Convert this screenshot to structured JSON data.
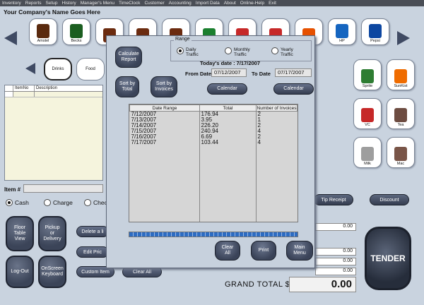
{
  "menubar": [
    "Inventory",
    "Reports",
    "Setup",
    "History",
    "Manager's Menu",
    "TimeClock",
    "Customer",
    "Accounting",
    "Import Data",
    "About",
    "Online-Help",
    "Exit"
  ],
  "company_name": "Your Company's Name Goes Here",
  "products_top": [
    {
      "label": "Amstel",
      "color": "#5a2a0e"
    },
    {
      "label": "Becks",
      "color": "#1b5e20"
    },
    {
      "label": "",
      "color": "#6b2b0f"
    },
    {
      "label": "",
      "color": "#6b2b0f"
    },
    {
      "label": "",
      "color": "#6b2b0f"
    },
    {
      "label": "",
      "color": "#1a7f2e"
    },
    {
      "label": "",
      "color": "#c62828"
    },
    {
      "label": "",
      "color": "#c62828"
    },
    {
      "label": "",
      "color": "#e65100"
    },
    {
      "label": "HP",
      "color": "#1565c0"
    },
    {
      "label": "Pepsi",
      "color": "#0d47a1"
    }
  ],
  "categories": [
    "Drinks",
    "Food"
  ],
  "products_right": [
    {
      "label": "Sprite",
      "color": "#2e7d32"
    },
    {
      "label": "SunKist",
      "color": "#ef6c00"
    },
    {
      "label": "VC",
      "color": "#c62828"
    },
    {
      "label": "Tea",
      "color": "#6d4c41"
    },
    {
      "label": "Milk",
      "color": "#9e9e9e"
    },
    {
      "label": "Mac",
      "color": "#795548"
    }
  ],
  "item_table": {
    "col_itemno": "ItemNo",
    "col_desc": "Description"
  },
  "item_label": "Item #",
  "payment": {
    "cash": "Cash",
    "charge": "Charge",
    "check": "Chec"
  },
  "left_buttons": {
    "floor": "Floor\nTable\nView",
    "pickup": "Pickup\nor\nDelivery",
    "logout": "Log-Out",
    "keyboard": "OnScreen\nKeyboard"
  },
  "mid_buttons": {
    "delete": "Delete a li",
    "edit": "Edit Pric",
    "custom": "Custom Item",
    "clear": "Clear All"
  },
  "right_buttons": {
    "tip": "Tip Receipt",
    "discount": "Discount"
  },
  "totals": {
    "t1": "0.00",
    "t2": "0.00",
    "t3": "0.00",
    "t4": "0.00"
  },
  "grand_total": {
    "label": "GRAND TOTAL  $",
    "value": "0.00"
  },
  "tender_label": "TENDER",
  "dialog": {
    "calc": "Calculate\nReport",
    "range_title": "Range",
    "daily": "Daily\nTraffic",
    "monthly": "Monthly\nTraffic",
    "yearly": "Yearly\nTraffic",
    "todays_date": "Today's date : 7/17/2007",
    "from_label": "From Date",
    "from_value": "07/12/2007",
    "to_label": "To Date",
    "to_value": "07/17/2007",
    "sort_total": "Sort by\nTotal",
    "sort_invoices": "Sort by\nInvoices",
    "calendar": "Calendar",
    "col_date": "Date Range",
    "col_total": "Total",
    "col_invoices": "Number of Invoices",
    "rows": [
      {
        "date": "7/12/2007",
        "total": "176.94",
        "inv": "2"
      },
      {
        "date": "7/13/2007",
        "total": "3.95",
        "inv": "1"
      },
      {
        "date": "7/14/2007",
        "total": "226.20",
        "inv": "2"
      },
      {
        "date": "7/15/2007",
        "total": "240.94",
        "inv": "4"
      },
      {
        "date": "7/16/2007",
        "total": "6.69",
        "inv": "2"
      },
      {
        "date": "7/17/2007",
        "total": "103.44",
        "inv": "4"
      }
    ],
    "clear_all": "Clear\nAll",
    "print": "Print",
    "main_menu": "Main\nMenu"
  }
}
